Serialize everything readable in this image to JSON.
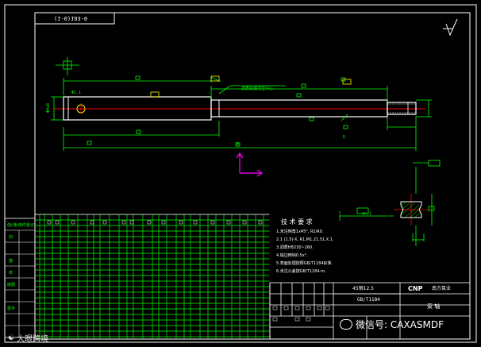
{
  "colors": {
    "background": "#000000",
    "frame": "#ffffff",
    "part_outline": "#ffffff",
    "dimension": "#00ff00",
    "centerline": "#ff0000",
    "ucs": "#ff00ff",
    "annotation": "#ffff00"
  },
  "drawing": {
    "code_box": "(1-0)103-0",
    "roughness_symbol": "roughness-icon",
    "notes_title": "技 术 要 求",
    "notes": [
      "1.未注倒角1x45°, R2/R0.",
      "2.1 (1.5)-X, R1,M1.21.51.X.1.",
      "3.调质HB230~260.",
      "4.锐边倒钝0.5x°.",
      "5.表面处理按照GB/T1184标准.",
      "6.未注公差按GB/T1184-m."
    ],
    "title_block": {
      "material": "45钢12.5",
      "standard": "GB/T1184",
      "company": "南方泵业",
      "logo_text": "CNP",
      "part_name": "泵 轴"
    }
  },
  "watermarks": {
    "wechat": "微信号: CAXASMDF",
    "left": "大眼跨境"
  }
}
